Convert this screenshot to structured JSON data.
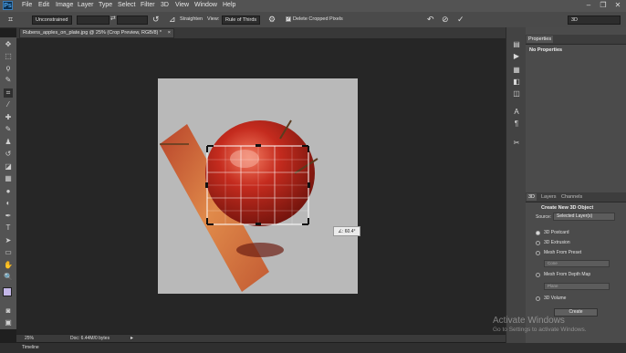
{
  "app": {
    "logo": "Ps"
  },
  "menu": [
    "File",
    "Edit",
    "Image",
    "Layer",
    "Type",
    "Select",
    "Filter",
    "3D",
    "View",
    "Window",
    "Help"
  ],
  "options": {
    "ratio_value": "Unconstrained",
    "straighten_label": "Straighten",
    "view_label": "View:",
    "view_value": "Rule of Thirds",
    "delete_cropped_label": "Delete Cropped Pixels",
    "delete_cropped_checked": true,
    "workspace_value": "3D"
  },
  "document": {
    "tab_title": "Rubens_apples_on_plate.jpg @ 25% (Crop Preview, RGB/8) *",
    "rotation_readout": "∠: 60.4°"
  },
  "status": {
    "zoom": "25%",
    "doc_info": "Doc: 6.44M/0 bytes"
  },
  "timeline_label": "Timeline",
  "properties": {
    "tab": "Properties",
    "title": "No Properties"
  },
  "panel3d": {
    "tabs": [
      "3D",
      "Layers",
      "Channels"
    ],
    "header": "Create New 3D Object",
    "source_label": "Source:",
    "source_value": "Selected Layer(s)",
    "options": [
      "3D Postcard",
      "3D Extrusion",
      "Mesh From Preset",
      "Mesh From Depth Map",
      "3D Volume"
    ],
    "preset_value": "Cone",
    "depth_value": "Plane",
    "create_label": "Create"
  },
  "watermark": {
    "line1": "Activate Windows",
    "line2": "Go to Settings to activate Windows."
  }
}
